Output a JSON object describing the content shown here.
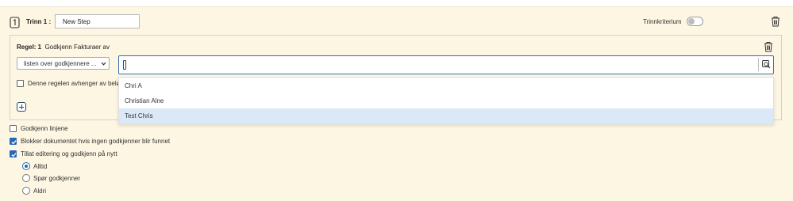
{
  "step": {
    "label": "Trinn 1 :",
    "name_value": "New Step",
    "criterion_label": "Trinnkriterium",
    "criterion_on": false
  },
  "rule": {
    "prefix": "Regel: 1",
    "title": "Godkjenn Fakturaer av",
    "source_select": "listen over godkjennere ...",
    "search_value": "",
    "depends_label": "Denne regelen avhenger av beløp"
  },
  "dropdown": {
    "options": [
      "Chri A",
      "Christian Alne",
      "Test Chris"
    ],
    "highlighted_index": 2
  },
  "options": {
    "approve_line": {
      "label": "Godkjenn linjene",
      "checked": false
    },
    "block_document": {
      "label": "Blokker dokumentet hvis ingen godkjenner blir funnet",
      "checked": true
    },
    "allow_edit": {
      "label": "Tillat editering og godkjenn på nytt",
      "checked": true
    }
  },
  "reapprove": {
    "options": [
      "Alltid",
      "Spør godkjenner",
      "Aldri"
    ],
    "selected_index": 0
  },
  "colors": {
    "panel_bg": "#fdf6e3",
    "accent": "#2568b5",
    "highlight": "#dbe8f7"
  },
  "icons": {
    "step": "step-badge-icon",
    "delete": "trash-icon",
    "search": "search-icon",
    "chevron": "chevron-down-icon",
    "add": "plus-icon"
  }
}
